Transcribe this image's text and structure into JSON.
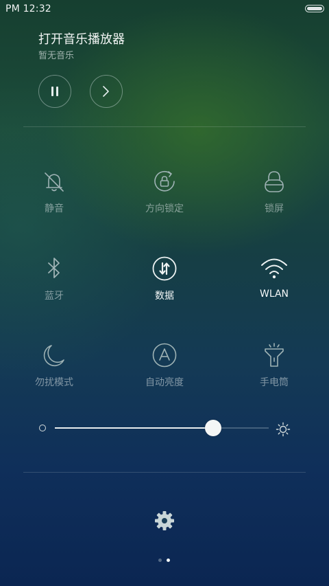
{
  "status_bar": {
    "time": "PM 12:32",
    "battery_icon": "battery-icon"
  },
  "music": {
    "title": "打开音乐播放器",
    "subtitle": "暂无音乐",
    "play_pause_icon": "pause-icon",
    "next_icon": "next-icon"
  },
  "toggles": [
    {
      "label": "静音",
      "icon": "bell-off-icon",
      "active": false
    },
    {
      "label": "方向锁定",
      "icon": "rotation-lock-icon",
      "active": false
    },
    {
      "label": "锁屏",
      "icon": "lock-icon",
      "active": false
    },
    {
      "label": "蓝牙",
      "icon": "bluetooth-icon",
      "active": false
    },
    {
      "label": "数据",
      "icon": "data-arrows-icon",
      "active": true
    },
    {
      "label": "WLAN",
      "icon": "wifi-icon",
      "active": true
    },
    {
      "label": "勿扰模式",
      "icon": "moon-icon",
      "active": false
    },
    {
      "label": "自动亮度",
      "icon": "auto-brightness-icon",
      "active": false
    },
    {
      "label": "手电筒",
      "icon": "flashlight-icon",
      "active": false
    }
  ],
  "brightness": {
    "level_percent": 74,
    "min_icon": "brightness-low-icon",
    "max_icon": "brightness-high-icon"
  },
  "settings_icon": "gear-icon",
  "pager": {
    "pages": 2,
    "current": 2
  },
  "colors": {
    "active_text": "#f4f7f7",
    "inactive_text": "#8fa3a6",
    "icon_inactive": "#9fb3b5",
    "icon_active": "#eef3f3"
  }
}
